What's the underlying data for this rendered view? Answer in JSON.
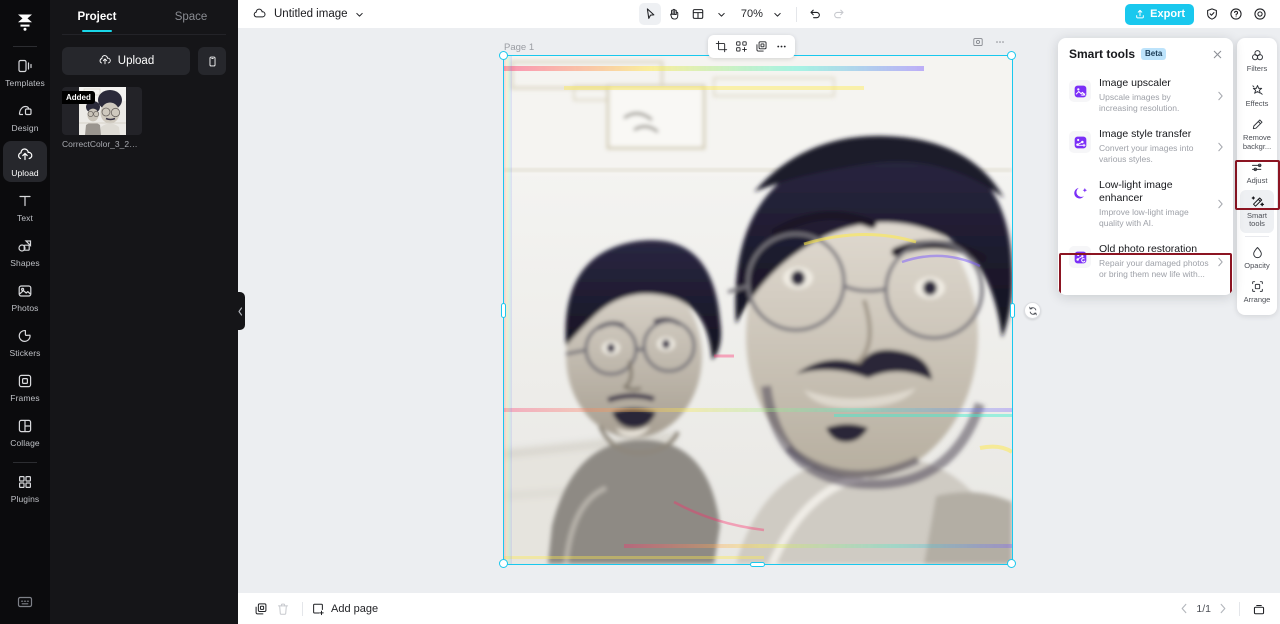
{
  "app": {
    "logo": "capcut-logo"
  },
  "left_rail": {
    "items": [
      {
        "icon": "templates-icon",
        "label": "Templates",
        "active": false
      },
      {
        "icon": "design-icon",
        "label": "Design",
        "active": false
      },
      {
        "icon": "upload-icon",
        "label": "Upload",
        "active": true
      },
      {
        "icon": "text-icon",
        "label": "Text",
        "active": false
      },
      {
        "icon": "shapes-icon",
        "label": "Shapes",
        "active": false
      },
      {
        "icon": "photos-icon",
        "label": "Photos",
        "active": false
      },
      {
        "icon": "stickers-icon",
        "label": "Stickers",
        "active": false
      },
      {
        "icon": "frames-icon",
        "label": "Frames",
        "active": false
      },
      {
        "icon": "collage-icon",
        "label": "Collage",
        "active": false
      },
      {
        "icon": "plugins-icon",
        "label": "Plugins",
        "active": false
      }
    ],
    "bottom_icon": "keyboard-shortcuts-icon"
  },
  "panel": {
    "tabs": [
      {
        "label": "Project",
        "active": true
      },
      {
        "label": "Space",
        "active": false
      }
    ],
    "upload_label": "Upload",
    "upload_icon": "cloud-upload-icon",
    "mobile_icon": "mobile-upload-icon",
    "assets": [
      {
        "badge": "Added",
        "name": "CorrectColor_3_202..."
      }
    ]
  },
  "topbar": {
    "cloud_icon": "cloud-sync-icon",
    "title": "Untitled image",
    "title_caret": "chevron-down-icon",
    "tools": [
      {
        "icon": "cursor-select-icon",
        "name": "select-tool",
        "selected": true
      },
      {
        "icon": "hand-pan-icon",
        "name": "hand-tool",
        "selected": false
      },
      {
        "icon": "layout-grid-icon",
        "name": "layout-tool",
        "selected": false
      }
    ],
    "layout_caret": "chevron-down-icon",
    "zoom": "70%",
    "zoom_caret": "chevron-down-icon",
    "undo_icon": "undo-icon",
    "redo_icon": "redo-icon",
    "export_label": "Export",
    "export_icon": "export-upload-icon",
    "export_color": "#19c8ee",
    "right_icons": [
      {
        "icon": "shield-check-icon",
        "name": "privacy-button"
      },
      {
        "icon": "help-circle-icon",
        "name": "help-button"
      },
      {
        "icon": "settings-gear-icon",
        "name": "settings-button"
      }
    ]
  },
  "canvas": {
    "page_label": "Page 1",
    "selection_color": "#19c8ee",
    "float_toolbar": [
      {
        "icon": "crop-icon",
        "name": "crop-button"
      },
      {
        "icon": "cutout-icon",
        "name": "cutout-button"
      },
      {
        "icon": "duplicate-icon",
        "name": "duplicate-button"
      },
      {
        "icon": "more-horizontal-icon",
        "name": "more-button"
      }
    ],
    "corner_tools": [
      {
        "icon": "image-lock-icon",
        "name": "image-options-button"
      },
      {
        "icon": "more-horizontal-icon",
        "name": "canvas-more-button"
      }
    ],
    "rotate_icon": "rotate-handle-icon"
  },
  "smart_tools_panel": {
    "title": "Smart tools",
    "badge": "Beta",
    "badge_bg": "#bde3fb",
    "close_icon": "close-icon",
    "highlight_color": "#8c1422",
    "items": [
      {
        "icon": "image-upscaler-icon",
        "name": "Image upscaler",
        "desc": "Upscale images by increasing resolution.",
        "arrow": "chevron-right-icon",
        "highlighted": false
      },
      {
        "icon": "style-transfer-icon",
        "name": "Image style transfer",
        "desc": "Convert your images into various styles.",
        "arrow": "chevron-right-icon",
        "highlighted": false
      },
      {
        "icon": "low-light-enhancer-icon",
        "name": "Low-light image enhancer",
        "desc": "Improve low-light image quality with AI.",
        "arrow": "chevron-right-icon",
        "highlighted": false
      },
      {
        "icon": "old-photo-restoration-icon",
        "name": "Old photo restoration",
        "desc": "Repair your damaged photos or bring them new life with...",
        "arrow": "chevron-right-icon",
        "highlighted": true
      }
    ]
  },
  "right_rail": {
    "items": [
      {
        "icon": "filters-icon",
        "label": "Filters",
        "active": false
      },
      {
        "icon": "effects-icon",
        "label": "Effects",
        "active": false
      },
      {
        "icon": "remove-background-icon",
        "label": "Remove backgr...",
        "active": false
      },
      {
        "icon": "adjust-icon",
        "label": "Adjust",
        "active": false
      },
      {
        "icon": "smart-tools-icon",
        "label": "Smart tools",
        "active": true
      },
      {
        "icon": "opacity-icon",
        "label": "Opacity",
        "active": false
      },
      {
        "icon": "arrange-icon",
        "label": "Arrange",
        "active": false
      }
    ],
    "highlight_color": "#8c1422"
  },
  "bottombar": {
    "duplicate_icon": "duplicate-page-icon",
    "delete_icon": "delete-page-icon",
    "add_page_label": "Add page",
    "add_page_icon": "add-page-icon",
    "page_indicator": "1/1",
    "prev_icon": "chevron-left-icon",
    "next_icon": "chevron-right-icon",
    "timeline_icon": "page-panel-icon"
  }
}
